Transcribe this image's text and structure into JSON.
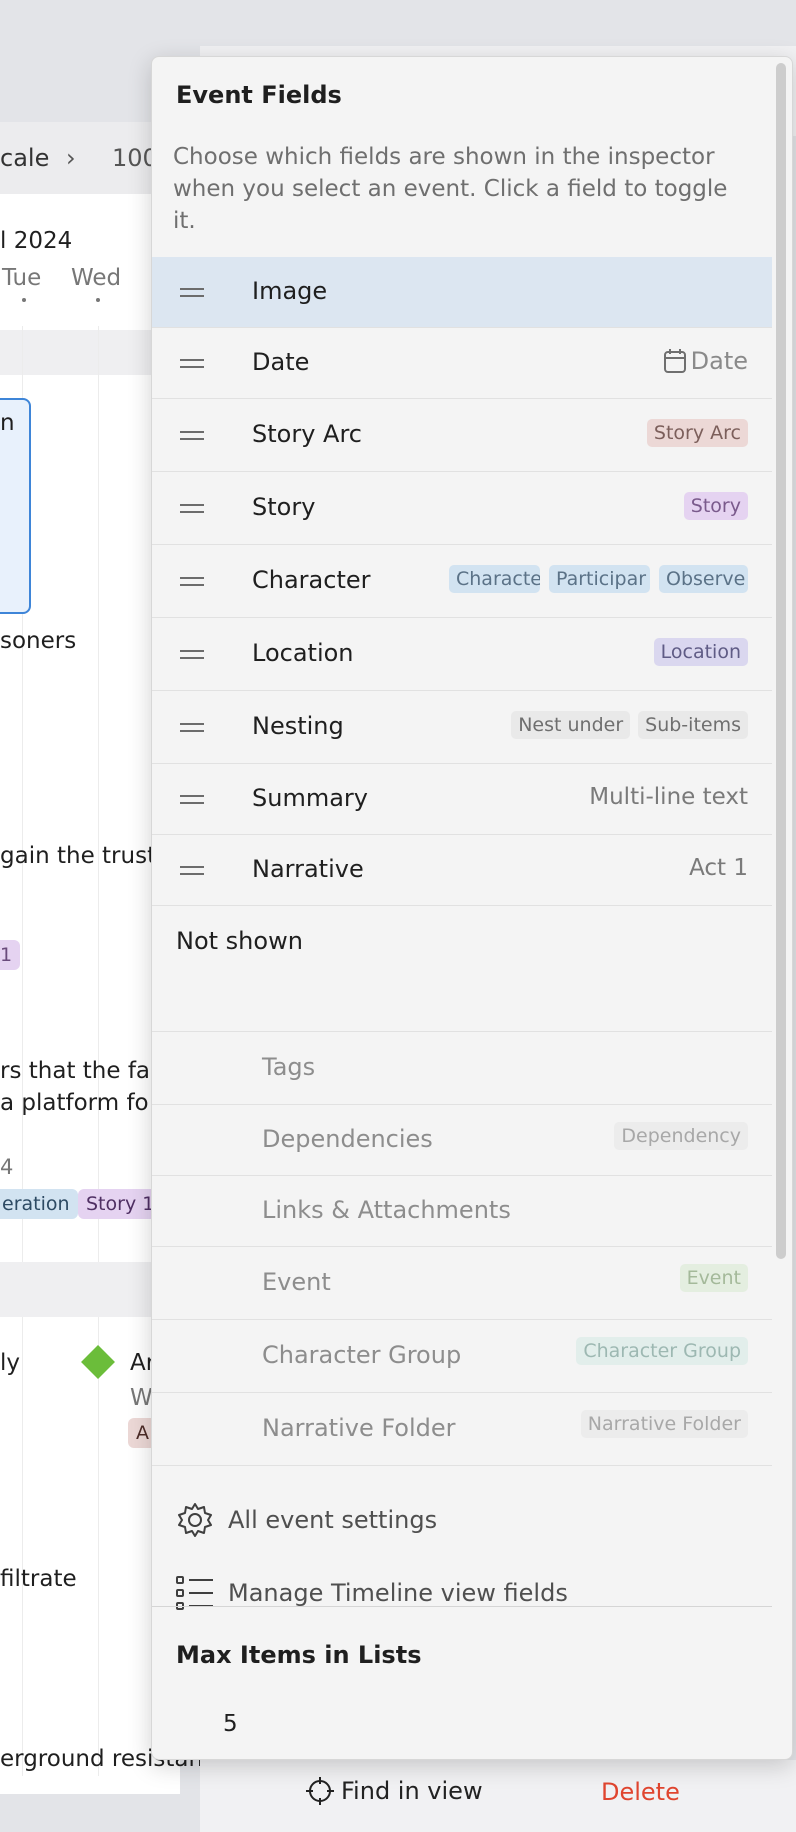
{
  "background": {
    "breadcrumb": {
      "item": "cale",
      "separator": "›",
      "next": "100"
    },
    "month_label": "l 2024",
    "weekdays": [
      "Tue",
      "Wed"
    ],
    "snippets": [
      "n",
      "soners",
      "gain the trust",
      "rs that the fac",
      " a platform fo",
      "4",
      "ly",
      "Ar",
      "W",
      "A",
      "filtrate",
      "erground resistan"
    ],
    "chips": [
      "eration",
      "Story 1",
      "1"
    ],
    "find_in_view": "Find in view",
    "delete": "Delete"
  },
  "popover": {
    "title": "Event Fields",
    "description": "Choose which fields are shown in the inspector when you select an event. Click a field to toggle it.",
    "shown_fields": [
      {
        "label": "Image",
        "selected": true
      },
      {
        "label": "Date",
        "right_text": "Date",
        "icon": "calendar-icon"
      },
      {
        "label": "Story Arc",
        "tags": [
          "Story Arc"
        ]
      },
      {
        "label": "Story",
        "tags": [
          "Story"
        ]
      },
      {
        "label": "Character",
        "tags": [
          "Characte",
          "Participar",
          "Observe"
        ]
      },
      {
        "label": "Location",
        "tags": [
          "Location"
        ]
      },
      {
        "label": "Nesting",
        "tags": [
          "Nest under",
          "Sub-items"
        ]
      },
      {
        "label": "Summary",
        "right_text": "Multi-line text"
      },
      {
        "label": "Narrative",
        "right_text": "Act 1"
      }
    ],
    "not_shown_label": "Not shown",
    "hidden_fields": [
      {
        "label": "Tags"
      },
      {
        "label": "Dependencies",
        "tags": [
          "Dependency"
        ]
      },
      {
        "label": "Links & Attachments"
      },
      {
        "label": "Event",
        "tags": [
          "Event"
        ]
      },
      {
        "label": "Character Group",
        "tags": [
          "Character Group"
        ]
      },
      {
        "label": "Narrative Folder",
        "tags": [
          "Narrative Folder"
        ]
      }
    ],
    "actions": {
      "all_settings": "All event settings",
      "manage_fields": "Manage Timeline view fields"
    },
    "max_items": {
      "title": "Max Items in Lists",
      "value": "5"
    }
  },
  "colors": {
    "selected_row": "#dce6f1",
    "accent_blue": "#3e85d8",
    "delete_red": "#e0452f",
    "milestone_green": "#6bbd3a"
  }
}
